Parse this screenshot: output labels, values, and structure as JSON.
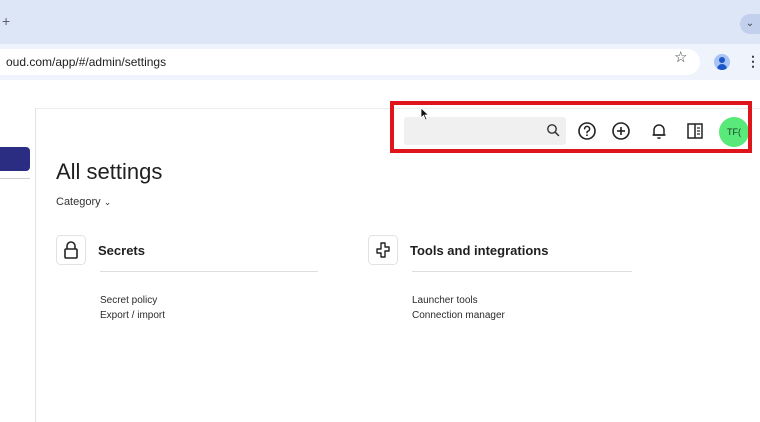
{
  "browser": {
    "new_tab_glyph": "+",
    "tab_dropdown_glyph": "⌄",
    "url": "oud.com/app/#/admin/settings",
    "star_glyph": "☆",
    "menu_glyph": "⋮"
  },
  "header": {
    "search_placeholder": "",
    "avatar_initials": "TF("
  },
  "main": {
    "title": "All settings",
    "category_label": "Category",
    "category_chevron": "⌄",
    "sections": [
      {
        "title": "Secrets",
        "icon": "lock-icon",
        "links": [
          "Secret policy",
          "Export / import"
        ]
      },
      {
        "title": "Tools and integrations",
        "icon": "plug-icon",
        "links": [
          "Launcher tools",
          "Connection manager"
        ]
      }
    ]
  },
  "colors": {
    "accent_nav": "#2b2d82",
    "avatar_bg": "#59e87a",
    "highlight_border": "#e0141b",
    "tabstrip_bg": "#dde6f7"
  },
  "icons": [
    "search-icon",
    "help-icon",
    "add-icon",
    "bell-icon",
    "panel-icon",
    "star-icon",
    "profile-icon",
    "menu-icon",
    "lock-icon",
    "plug-icon",
    "cursor-icon"
  ]
}
